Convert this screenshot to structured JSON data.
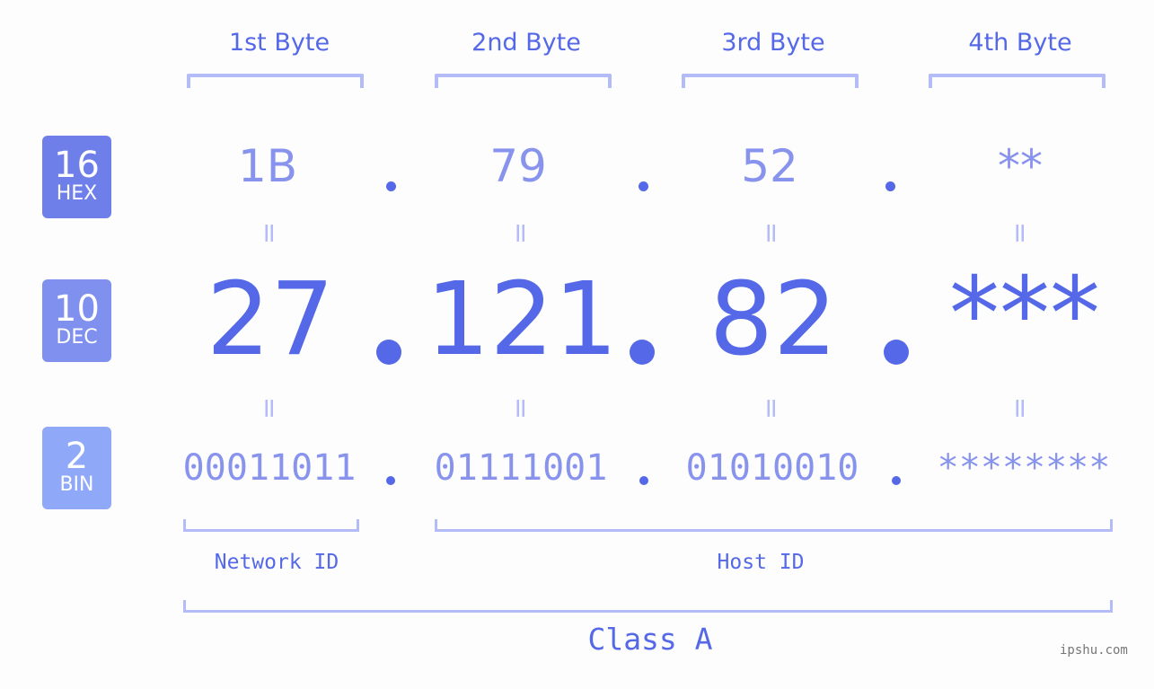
{
  "byte_headers": [
    "1st Byte",
    "2nd Byte",
    "3rd Byte",
    "4th Byte"
  ],
  "badges": {
    "hex": {
      "number": "16",
      "label": "HEX",
      "color": "#6f7fea"
    },
    "dec": {
      "number": "10",
      "label": "DEC",
      "color": "#8090ef"
    },
    "bin": {
      "number": "2",
      "label": "BIN",
      "color": "#8fa8f8"
    }
  },
  "hex_values": [
    "1B",
    "79",
    "52",
    "**"
  ],
  "dec_values": [
    "27",
    "121",
    "82",
    "***"
  ],
  "bin_values": [
    "00011011",
    "01111001",
    "01010010",
    "********"
  ],
  "equals_sign": "=",
  "separator": ".",
  "network_id_label": "Network ID",
  "host_id_label": "Host ID",
  "class_label": "Class A",
  "watermark": "ipshu.com",
  "colors": {
    "primary": "#5468e8",
    "light": "#8893ee",
    "bracket": "#b3bcf7"
  }
}
